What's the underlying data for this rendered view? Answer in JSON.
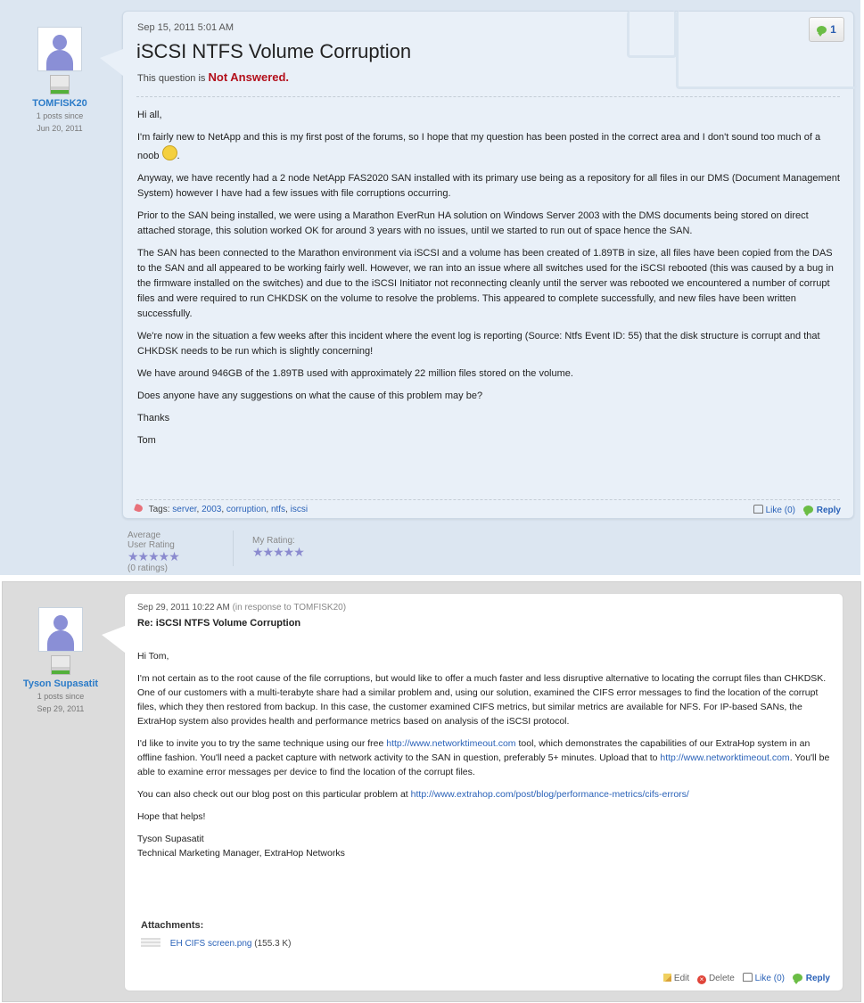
{
  "question": {
    "author": {
      "name": "TOMFISK20",
      "posts_since": "1 posts since",
      "since_date": "Jun 20, 2011"
    },
    "date": "Sep 15, 2011 5:01 AM",
    "title": "iSCSI NTFS Volume Corruption",
    "status_prefix": "This question is",
    "status_value": "Not Answered.",
    "reply_count": "1",
    "body": {
      "greeting": "Hi all,",
      "p1_text": "I'm fairly new to NetApp and this is my first post of the forums, so I hope that my question has been posted in the correct area and I don't sound too much of a noob",
      "p1_end": ".",
      "p2": "Anyway, we have recently had a 2 node NetApp FAS2020 SAN installed with its primary use being as a repository for all files in our DMS (Document Management System) however I have had a few issues with file corruptions occurring.",
      "p3": "Prior to the SAN being installed, we were using a Marathon EverRun HA solution on Windows Server 2003 with the DMS documents being stored on direct attached storage, this solution worked OK for around 3 years with no issues, until we started to run out of space hence the SAN.",
      "p4": "The SAN has been connected to the Marathon environment via iSCSI and a volume has been created of 1.89TB in size, all files have been copied from the DAS to the SAN and all appeared to be working fairly well.  However, we ran into an issue where all switches used for the iSCSI rebooted (this was caused by a bug in the firmware installed on the switches) and due to the iSCSI Initiator not reconnecting cleanly until the server was rebooted we encountered a number of corrupt files and were required to run CHKDSK on the volume to resolve the problems.  This appeared to complete successfully, and new files have been written successfully.",
      "p5": "We're now in the situation a few weeks after this incident where the event log is reporting (Source: Ntfs  Event ID: 55) that the disk structure is corrupt and that CHKDSK needs to be run which is slightly concerning!",
      "p6": "We have around 946GB of the 1.89TB used with approximately 22 million files stored on the volume.",
      "p7": "Does anyone have any suggestions on what the cause of this problem may be?",
      "p8": "Thanks",
      "p9": "Tom"
    },
    "tags_label": "Tags:",
    "tags": [
      "server",
      "2003",
      "corruption",
      "ntfs",
      "iscsi"
    ],
    "like_label": "Like (0)",
    "reply_label": "Reply",
    "ratings": {
      "average_label": "Average User Rating",
      "average_stars": 0,
      "average_count": "(0 ratings)",
      "my_label": "My Rating:",
      "my_stars": 0,
      "star_glyphs": "★★★★★"
    }
  },
  "reply": {
    "author": {
      "name": "Tyson Supasatit",
      "posts_since": "1 posts since",
      "since_date": "Sep 29, 2011"
    },
    "date": "Sep 29, 2011 10:22 AM",
    "in_response": "(in response to TOMFISK20)",
    "title": "Re: iSCSI NTFS Volume Corruption",
    "body": {
      "greeting": "Hi Tom,",
      "p1": "I'm not certain as to the root cause of the file corruptions, but would like to offer a much faster and less disruptive alternative to locating the corrupt files than CHKDSK. One of our customers with a multi-terabyte share had a similar problem and, using our solution, examined the CIFS error messages to find the location of the corrupt files, which they then restored from backup. In this case, the customer examined CIFS metrics, but similar metrics are available for NFS. For IP-based SANs, the ExtraHop system also provides health and performance metrics based on analysis of the iSCSI protocol.",
      "p2_a": "I'd like to invite you to try the same technique using our free",
      "p2_link1": "http://www.networktimeout.com",
      "p2_b": "tool, which demonstrates the capabilities of our ExtraHop system in an offline fashion. You'll need a packet capture with network activity to the SAN in question, preferably 5+ minutes. Upload that to",
      "p2_link2": "http://www.networktimeout.com",
      "p2_c": ". You'll be able to examine error messages per device to find the location of the corrupt files.",
      "p3_a": "You can also check out our blog post on this particular problem at",
      "p3_link": "http://www.extrahop.com/post/blog/performance-metrics/cifs-errors/",
      "p4": "Hope that helps!",
      "sig_name": "Tyson Supasatit",
      "sig_title": "Technical Marketing Manager, ExtraHop Networks"
    },
    "attachments_label": "Attachments:",
    "attachment": {
      "name": "EH CIFS screen.png",
      "size": "(155.3 K)"
    },
    "actions": {
      "edit": "Edit",
      "delete": "Delete",
      "like": "Like (0)",
      "reply": "Reply"
    }
  }
}
